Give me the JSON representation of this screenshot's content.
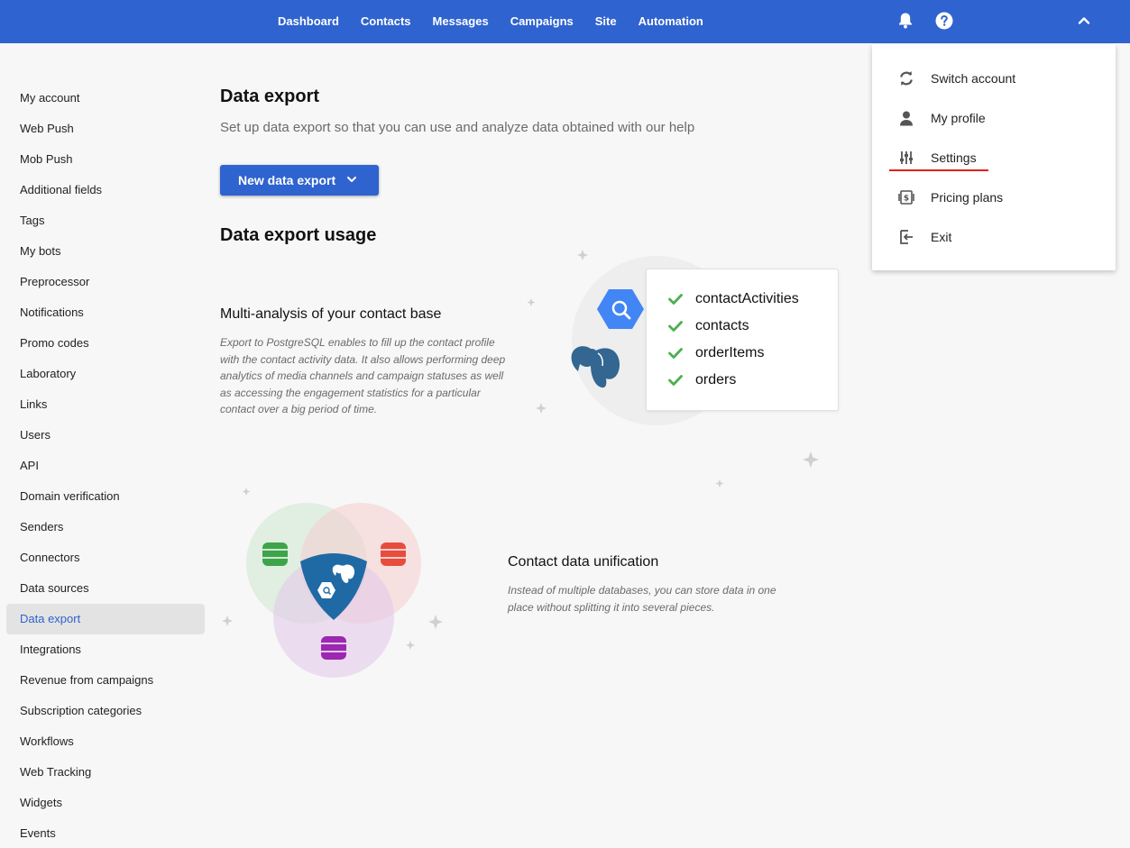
{
  "topnav": {
    "items": [
      "Dashboard",
      "Contacts",
      "Messages",
      "Campaigns",
      "Site",
      "Automation"
    ],
    "icons": [
      "bell-icon",
      "help-icon",
      "chevron-up-icon"
    ]
  },
  "sidebar": {
    "items": [
      "My account",
      "Web Push",
      "Mob Push",
      "Additional fields",
      "Tags",
      "My bots",
      "Preprocessor",
      "Notifications",
      "Promo codes",
      "Laboratory",
      "Links",
      "Users",
      "API",
      "Domain verification",
      "Senders",
      "Connectors",
      "Data sources",
      "Data export",
      "Integrations",
      "Revenue from campaigns",
      "Subscription categories",
      "Workflows",
      "Web Tracking",
      "Widgets",
      "Events"
    ],
    "active": "Data export"
  },
  "main": {
    "title": "Data export",
    "subtitle": "Set up data export so that you can use and analyze data obtained with our help",
    "new_button": "New data export",
    "usage_title": "Data export usage",
    "block1": {
      "title": "Multi-analysis of your contact base",
      "text": "Export to PostgreSQL enables to fill up the contact profile with the contact activity data. It also allows performing deep analytics of media channels and campaign statuses as well as accessing the engagement statistics for a particular contact over a big period of time."
    },
    "card_items": [
      "contactActivities",
      "contacts",
      "orderItems",
      "orders"
    ],
    "block2": {
      "title": "Contact data unification",
      "text": "Instead of multiple databases, you can store data in one place without splitting it into several pieces."
    }
  },
  "dropdown": {
    "items": [
      {
        "label": "Switch account",
        "icon": "sync-icon"
      },
      {
        "label": "My profile",
        "icon": "person-icon"
      },
      {
        "label": "Settings",
        "icon": "sliders-icon"
      },
      {
        "label": "Pricing plans",
        "icon": "money-icon"
      },
      {
        "label": "Exit",
        "icon": "exit-icon"
      }
    ],
    "highlighted": "Settings"
  },
  "colors": {
    "brand_blue": "#2f63cf",
    "check_green": "#4caf50",
    "underline_red": "#e0201e",
    "db_green": "#3da44a",
    "db_red": "#e74c3c",
    "db_purple": "#9c27b0"
  }
}
